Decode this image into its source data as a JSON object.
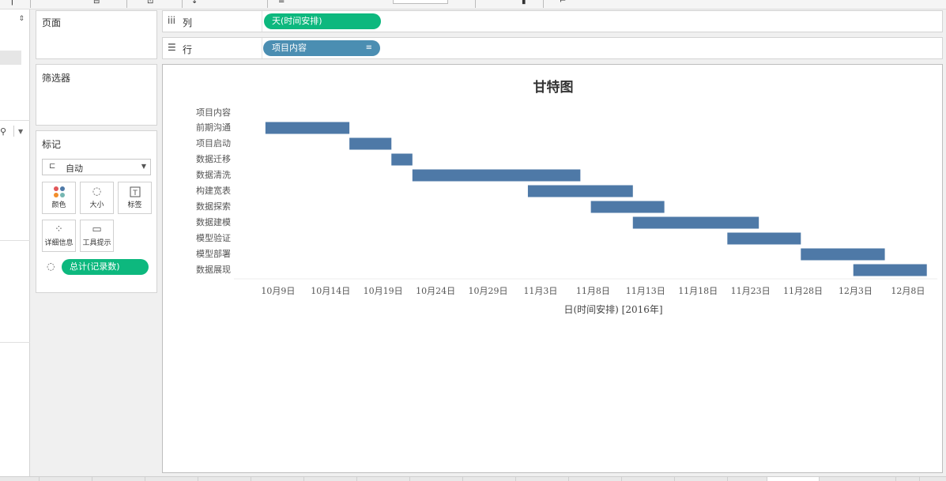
{
  "panels": {
    "pages_title": "页面",
    "filters_title": "筛选器",
    "marks_title": "标记"
  },
  "marks": {
    "type_label": "自动",
    "buttons": [
      "颜色",
      "大小",
      "标签",
      "详细信息",
      "工具提示"
    ],
    "count_pill": "总计(记录数)"
  },
  "shelves": {
    "columns_label": "列",
    "columns_pill": "天(时间安排)",
    "rows_label": "行",
    "rows_pill": "项目内容"
  },
  "colors": {
    "bar": "#4e79a7",
    "pill_green": "#0db87e",
    "pill_blue": "#4b8eb2"
  },
  "chart_data": {
    "type": "bar",
    "orientation": "horizontal-gantt",
    "title": "甘特图",
    "row_header": "项目内容",
    "categories": [
      "前期沟通",
      "项目启动",
      "数据迁移",
      "数据清洗",
      "构建宽表",
      "数据探索",
      "数据建模",
      "模型验证",
      "模型部署",
      "数据展现"
    ],
    "series": [
      {
        "start": [
          "2016-10-09",
          "2016-10-17",
          "2016-10-21",
          "2016-10-23",
          "2016-11-03",
          "2016-11-09",
          "2016-11-13",
          "2016-11-22",
          "2016-11-29",
          "2016-12-04"
        ],
        "end": [
          "2016-10-17",
          "2016-10-21",
          "2016-10-23",
          "2016-11-08",
          "2016-11-13",
          "2016-11-16",
          "2016-11-25",
          "2016-11-29",
          "2016-12-07",
          "2016-12-11"
        ]
      }
    ],
    "x_ticks": [
      "10月9日",
      "10月14日",
      "10月19日",
      "10月24日",
      "10月29日",
      "11月3日",
      "11月8日",
      "11月13日",
      "11月18日",
      "11月23日",
      "11月28日",
      "12月3日",
      "12月8日"
    ],
    "xlabel": "日(时间安排) [2016年]",
    "xlim": [
      "2016-10-06",
      "2016-12-12"
    ],
    "grid": false
  }
}
